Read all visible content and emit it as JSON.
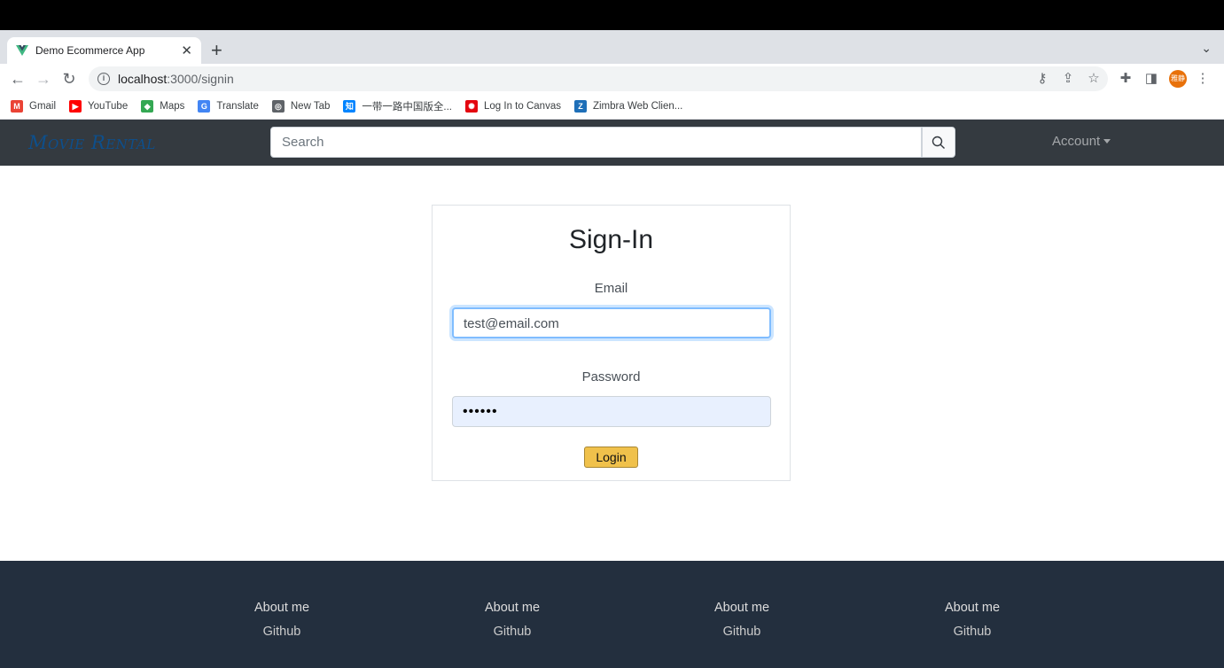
{
  "browser": {
    "tab_title": "Demo Ecommerce App",
    "url_host": "localhost",
    "url_path": ":3000/signin",
    "profile_label": "雅静"
  },
  "bookmarks": [
    {
      "label": "Gmail",
      "icon": "gmail-icon",
      "color": "#ea4335",
      "glyph": "M"
    },
    {
      "label": "YouTube",
      "icon": "youtube-icon",
      "color": "#ff0000",
      "glyph": "▶"
    },
    {
      "label": "Maps",
      "icon": "maps-icon",
      "color": "#34a853",
      "glyph": "◆"
    },
    {
      "label": "Translate",
      "icon": "translate-icon",
      "color": "#4285f4",
      "glyph": "G"
    },
    {
      "label": "New Tab",
      "icon": "globe-icon",
      "color": "#5f6368",
      "glyph": "◎"
    },
    {
      "label": "一带一路中国版全...",
      "icon": "zhihu-icon",
      "color": "#0084ff",
      "glyph": "知"
    },
    {
      "label": "Log In to Canvas",
      "icon": "canvas-icon",
      "color": "#e4060f",
      "glyph": "✺"
    },
    {
      "label": "Zimbra Web Clien...",
      "icon": "zimbra-icon",
      "color": "#1e6fb8",
      "glyph": "Z"
    }
  ],
  "navbar": {
    "brand": "Movie Rental",
    "search_placeholder": "Search",
    "account_label": "Account"
  },
  "signin": {
    "title": "Sign-In",
    "email_label": "Email",
    "email_value": "test@email.com",
    "password_label": "Password",
    "password_value": "••••••",
    "login_label": "Login"
  },
  "footer": {
    "columns": [
      {
        "about": "About me",
        "link": "Github"
      },
      {
        "about": "About me",
        "link": "Github"
      },
      {
        "about": "About me",
        "link": "Github"
      },
      {
        "about": "About me",
        "link": "Github"
      }
    ]
  },
  "colors": {
    "navbar_bg": "#343a40",
    "footer_bg": "#232f3e",
    "login_button": "#f0c14b",
    "brand_text": "#0d4f8c"
  }
}
